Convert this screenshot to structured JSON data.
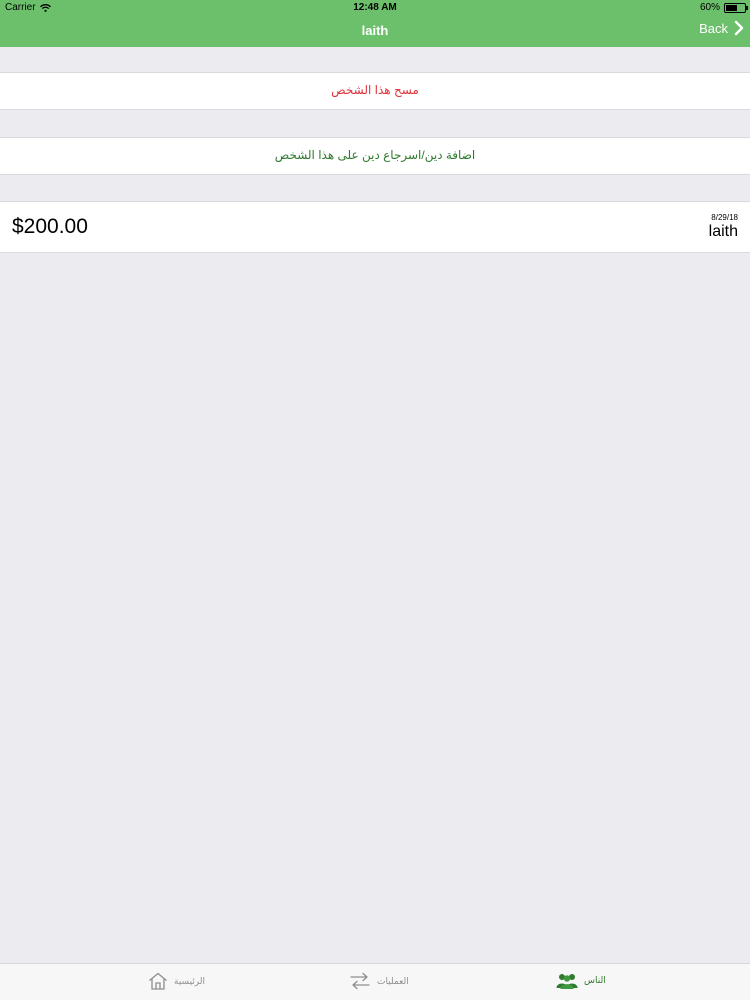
{
  "status_bar": {
    "carrier": "Carrier",
    "time": "12:48 AM",
    "battery": "60%",
    "battery_level": 0.6
  },
  "nav": {
    "title": "laith",
    "back_label": "Back",
    "color": "#6cc06c"
  },
  "actions": {
    "delete_label": "مسح هذا الشخص",
    "add_debt_label": "اضافة دين/اسرجاع دين على هذا الشخص",
    "delete_color": "#e0303a",
    "add_color": "#2f7a2f"
  },
  "entries": [
    {
      "amount": "$200.00",
      "date": "8/29/18",
      "name": "laith"
    }
  ],
  "tab_bar": {
    "tabs": [
      {
        "label": "الرئيسية",
        "icon": "home-icon",
        "selected": false
      },
      {
        "label": "العمليات",
        "icon": "transfer-icon",
        "selected": false
      },
      {
        "label": "الناس",
        "icon": "people-icon",
        "selected": true
      }
    ]
  }
}
